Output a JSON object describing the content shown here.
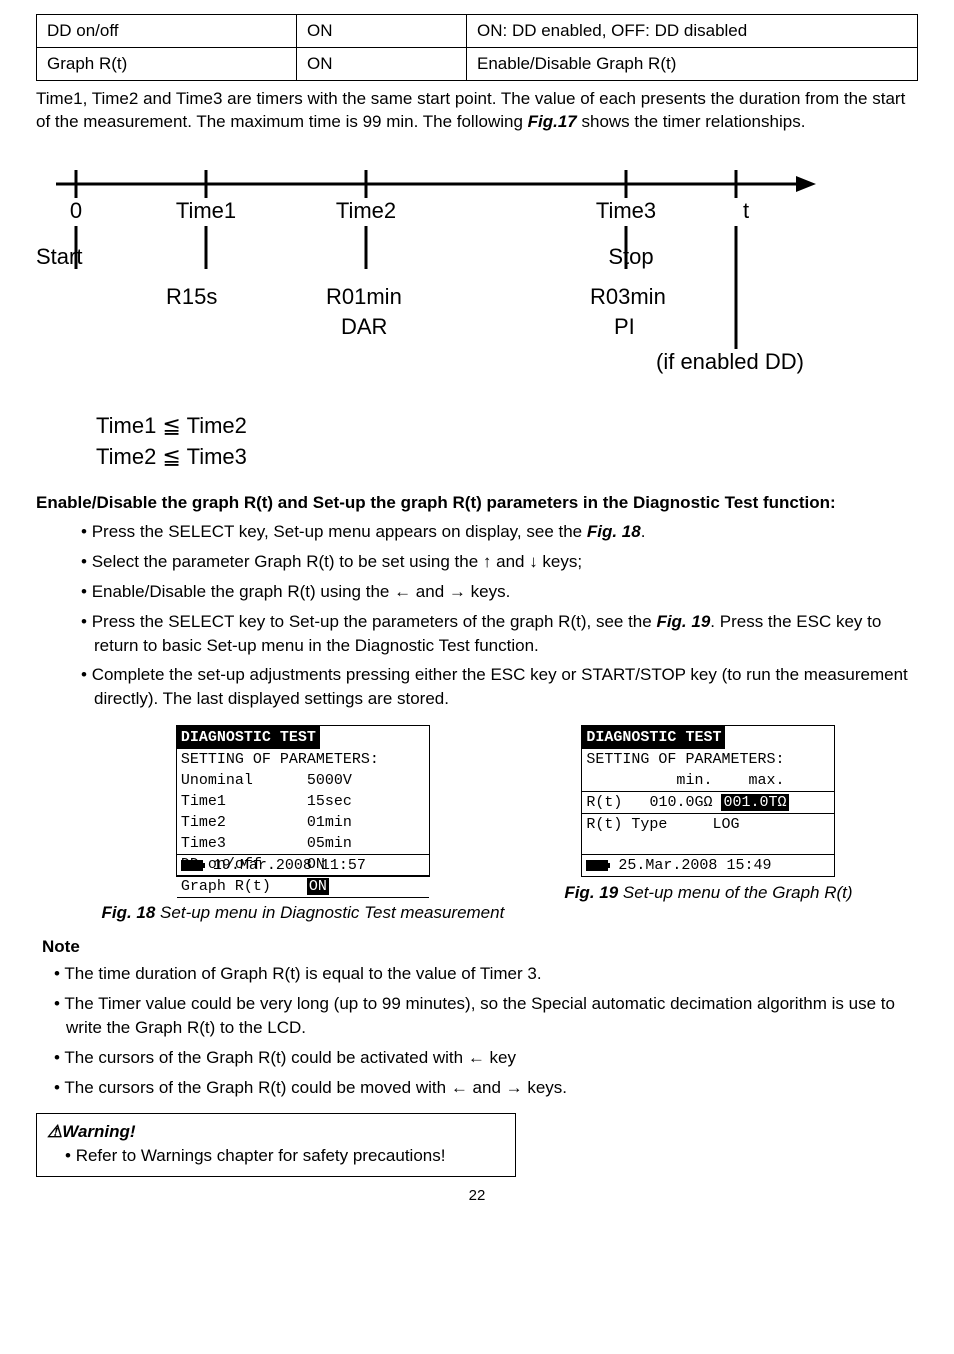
{
  "table": {
    "r1": {
      "name": "DD on/off",
      "val": "ON",
      "desc": "ON: DD enabled, OFF: DD disabled"
    },
    "r2": {
      "name": "Graph R(t)",
      "val": "ON",
      "desc": "Enable/Disable Graph R(t)"
    }
  },
  "intro": {
    "text_a": "Time1, Time2 and Time3 are timers with the same start point. The value of each presents the duration from the start of the measurement. The maximum time is 99 min. The following ",
    "figref": "Fig.17",
    "text_b": " shows the timer relationships."
  },
  "diagram": {
    "zero": "0",
    "t1": "Time1",
    "t2": "Time2",
    "t3": "Time3",
    "t": "t",
    "start": "Start",
    "stop": "Stop",
    "r15s": "R15s",
    "r01": "R01min",
    "r03": "R03min",
    "dar": "DAR",
    "pi": "PI",
    "ifdd": "(if enabled DD)"
  },
  "timerel": {
    "l1": "Time1 ≦ Time2",
    "l2": "Time2 ≦ Time3"
  },
  "subhead": "Enable/Disable the graph R(t) and Set-up the graph R(t) parameters in the Diagnostic Test function:",
  "steps": {
    "s1a": "Press the SELECT key, Set-up menu appears on display, see the ",
    "s1f": "Fig. 18",
    "s1b": ".",
    "s2": "Select the parameter Graph R(t) to be set using the ↑ and ↓ keys;",
    "s3": "Enable/Disable the graph R(t) using the ← and → keys.",
    "s4a": "Press the SELECT key to Set-up the parameters of the graph R(t), see the ",
    "s4f": "Fig. 19",
    "s4b": ". Press the ESC key to return to basic Set-up menu in the Diagnostic Test function.",
    "s5": "Complete the set-up adjustments pressing either the ESC key or START/STOP key (to run the measurement directly). The last displayed settings are stored."
  },
  "lcd18": {
    "title": "DIAGNOSTIC TEST",
    "sub": "SETTING OF PARAMETERS:",
    "r_un": "Unominal      5000V",
    "r_t1": "Time1         15sec",
    "r_t2": "Time2         01min",
    "r_t3": "Time3         05min",
    "r_dd_l": "DD on/off",
    "r_dd_v": "ON",
    "r_gr_l": "Graph R(t)",
    "r_gr_v": "ON",
    "date": "19.Mar.2008 11:57"
  },
  "lcd19": {
    "title": "DIAGNOSTIC TEST",
    "sub": "SETTING OF PARAMETERS:",
    "hdr": "          min.    max.",
    "row1_l": "R(t)",
    "row1_m": "010.0GΩ",
    "row1_x": "001.0TΩ",
    "row2": "R(t) Type     LOG",
    "date": "25.Mar.2008 15:49"
  },
  "figcap18": {
    "num": "Fig. 18",
    "text": "  Set-up menu in Diagnostic Test measurement"
  },
  "figcap19": {
    "num": "Fig. 19",
    "text": "  Set-up menu of the Graph R(t)"
  },
  "notehdr": "Note",
  "notes": {
    "n1": "The time duration of Graph R(t) is equal to the value of Timer 3.",
    "n2": "The Timer value could be very long (up to 99 minutes), so the Special automatic decimation algorithm is use to write the Graph R(t) to the LCD.",
    "n3": "The cursors of the Graph R(t) could be activated with ← key",
    "n4": "The cursors of the Graph R(t) could be moved with ← and → keys."
  },
  "warnhead": "⚠Warning!",
  "warnbody": "Refer to Warnings chapter for safety precautions!",
  "pagenum": "22"
}
